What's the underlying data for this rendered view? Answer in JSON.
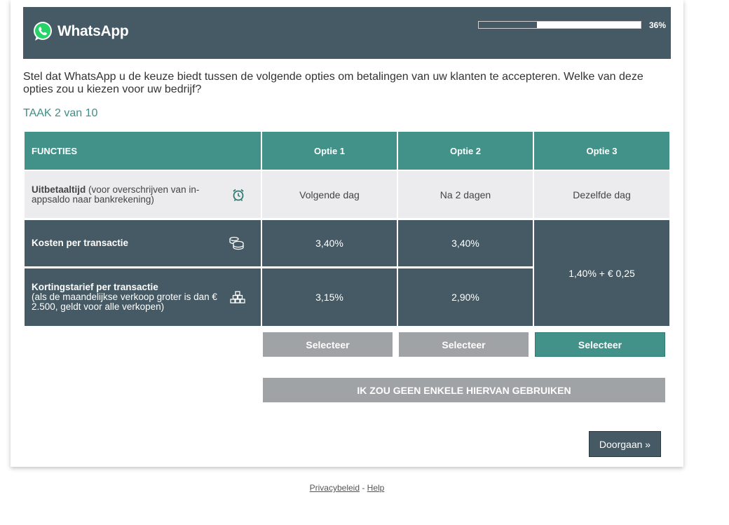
{
  "brand": {
    "name": "WhatsApp",
    "header_color": "#455a64",
    "accent": "#43928a"
  },
  "progress": {
    "percent_value": 36,
    "label": "36%"
  },
  "question": "Stel dat WhatsApp u de keuze biedt tussen de volgende opties om betalingen van uw klanten te accepteren. Welke van deze opties zou u kiezen voor uw bedrijf?",
  "task_label": "TAAK 2 van 10",
  "table": {
    "headers": [
      "FUNCTIES",
      "Optie 1",
      "Optie 2",
      "Optie 3"
    ],
    "rows": [
      {
        "feature_bold": "Uitbetaaltijd",
        "feature_rest": " (voor overschrijven van in-appsaldo naar bankrekening)",
        "icon": "alarm-clock-icon",
        "values": [
          "Volgende dag",
          "Na 2 dagen",
          "Dezelfde dag"
        ]
      },
      {
        "feature_bold": "Kosten per transactie",
        "feature_rest": "",
        "icon": "coins-icon",
        "values": [
          "3,40%",
          "3,40%",
          "1,40% + € 0,25"
        ]
      },
      {
        "feature_bold": "Kortingstarief per transactie",
        "feature_rest": "(als de maandelijkse verkoop groter is dan € 2.500, geldt voor alle verkopen)",
        "icon": "stacked-boxes-icon",
        "values": [
          "3,15%",
          "2,90%",
          "1,40% + € 0,25"
        ]
      }
    ]
  },
  "buttons": {
    "select": [
      "Selecteer",
      "Selecteer",
      "Selecteer"
    ],
    "selected_option": 3,
    "none": "IK ZOU GEEN ENKELE HIERVAN GEBRUIKEN",
    "next": "Doorgaan »"
  },
  "footer": {
    "privacy": "Privacybeleid",
    "separator": " - ",
    "help": "Help"
  }
}
